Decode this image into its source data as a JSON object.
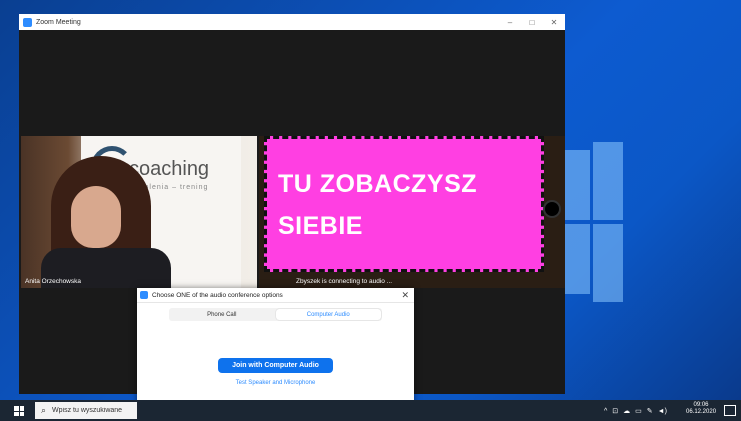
{
  "window": {
    "title": "Zoom Meeting",
    "controls": [
      "–",
      "□",
      "✕"
    ]
  },
  "left_video": {
    "participant_name": "Anita Orzechowska",
    "banner_brand": "coaching",
    "banner_sub": "szkolenia – trening"
  },
  "right_video": {
    "overlay_line1": "TU ZOBACZYSZ",
    "overlay_line2": "SIEBIE",
    "status_text": "Zbyszek is connecting to audio ..."
  },
  "dialog": {
    "title": "Choose ONE of the audio conference options",
    "close_label": "✕",
    "tabs": [
      {
        "label": "Phone Call",
        "active": false
      },
      {
        "label": "Computer Audio",
        "active": true
      }
    ],
    "join_button": "Join with Computer Audio",
    "test_link": "Test Speaker and Microphone"
  },
  "taskbar": {
    "search_placeholder": "Wpisz tu wyszukiwane",
    "tray_icons": [
      "chevron-up-icon",
      "network-icon",
      "cloud-icon",
      "battery-icon",
      "pen-icon",
      "volume-icon"
    ],
    "time": "09:06",
    "date": "06.12.2020"
  },
  "colors": {
    "zoom_blue": "#2d8cff",
    "join_blue": "#0e72ed",
    "overlay_magenta": "#ff3fe2"
  }
}
